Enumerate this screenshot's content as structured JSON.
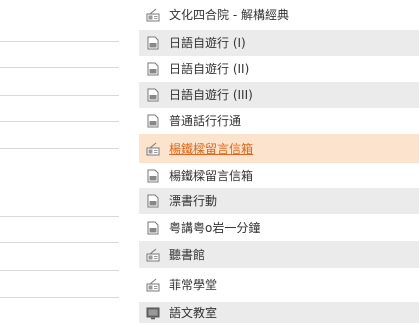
{
  "menu": {
    "items": [
      {
        "label": "文化四合院 - 解構經典",
        "icon": "radio-icon"
      },
      {
        "label": "日語自遊行 (I)",
        "icon": "document-icon"
      },
      {
        "label": "日語自遊行 (II)",
        "icon": "document-icon"
      },
      {
        "label": "日語自遊行 (III)",
        "icon": "document-icon"
      },
      {
        "label": "普通話行行通",
        "icon": "document-icon"
      },
      {
        "label": "楊鐵樑留言信箱",
        "icon": "radio-icon",
        "active": true
      },
      {
        "label": "楊鐵樑留言信箱",
        "icon": "document-icon"
      },
      {
        "label": "漂書行動",
        "icon": "document-icon"
      },
      {
        "label": "粤講粤o岩一分鐘",
        "icon": "document-icon"
      },
      {
        "label": "聽書館",
        "icon": "radio-icon"
      },
      {
        "label": "菲常學堂",
        "icon": "radio-icon"
      },
      {
        "label": "語文教室",
        "icon": "tv-icon"
      }
    ]
  },
  "colors": {
    "active_background": "#fce3cd",
    "active_text": "#e0661c",
    "stripe": "#ebebeb"
  }
}
